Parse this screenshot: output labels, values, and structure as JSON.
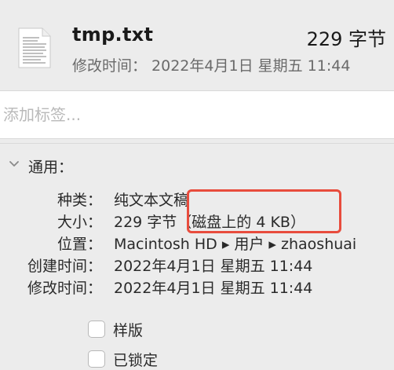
{
  "file": {
    "name": "tmp.txt",
    "size": "229 字节",
    "modified_line": "修改时间： 2022年4月1日 星期五 11:44",
    "icon": "text-document-icon"
  },
  "tags": {
    "placeholder": "添加标签..."
  },
  "general": {
    "title": "通用：",
    "toggle_icon": "chevron-down-icon",
    "rows": [
      {
        "label": "种类：",
        "value": "纯文本文稿"
      },
      {
        "label": "大小：",
        "value": "229 字节（磁盘上的 4 KB）"
      },
      {
        "label": "位置：",
        "value": "Macintosh HD ▸ 用户 ▸ zhaoshuai"
      },
      {
        "label": "创建时间：",
        "value": "2022年4月1日 星期五 11:44"
      },
      {
        "label": "修改时间：",
        "value": "2022年4月1日 星期五 11:44"
      }
    ],
    "checkboxes": [
      {
        "label": "样版",
        "checked": false
      },
      {
        "label": "已锁定",
        "checked": false
      }
    ]
  },
  "colors": {
    "highlight": "#e84c3d",
    "background": "#ececec"
  }
}
